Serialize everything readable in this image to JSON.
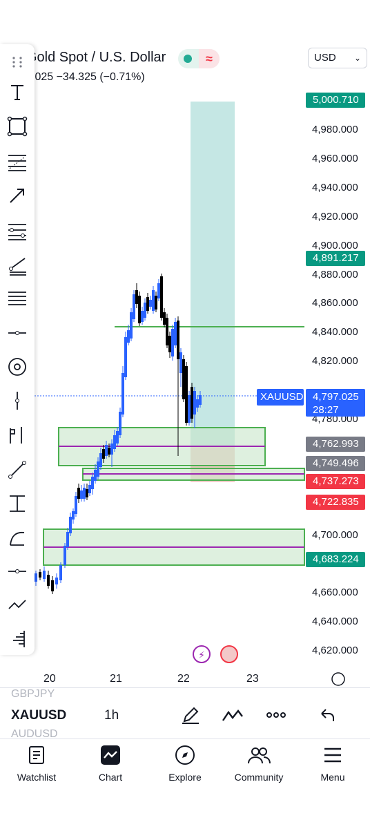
{
  "header": {
    "title": "Gold Spot / U.S. Dollar",
    "subtitle": ".025  −34.325 (−0.71%)",
    "currency": "USD"
  },
  "price_axis": {
    "ticks": [
      "4,980.000",
      "4,960.000",
      "4,940.000",
      "4,920.000",
      "4,900.000",
      "4,880.000",
      "4,860.000",
      "4,840.000",
      "4,820.000",
      "4,780.000",
      "4,700.000",
      "4,660.000",
      "4,640.000",
      "4,620.000"
    ],
    "tags": [
      {
        "text": "5,000.710",
        "color": "#089981"
      },
      {
        "text": "4,891.217",
        "color": "#089981"
      },
      {
        "text": "4,762.993",
        "color": "#787b86"
      },
      {
        "text": "4,749.496",
        "color": "#787b86"
      },
      {
        "text": "4,737.273",
        "color": "#f23645"
      },
      {
        "text": "4,722.835",
        "color": "#f23645"
      },
      {
        "text": "4,683.224",
        "color": "#089981"
      }
    ],
    "current": {
      "symbol": "XAUUSD",
      "price": "4,797.025",
      "countdown": "28:27",
      "color": "#2962ff"
    }
  },
  "time_axis": [
    "20",
    "21",
    "22",
    "23"
  ],
  "bottom_strip": {
    "prev_symbol": "GBPJPY",
    "symbol": "XAUUSD",
    "interval": "1h",
    "next_symbol": "AUDUSD"
  },
  "nav": [
    {
      "label": "Watchlist",
      "icon": "watchlist-icon"
    },
    {
      "label": "Chart",
      "icon": "chart-icon"
    },
    {
      "label": "Explore",
      "icon": "explore-icon"
    },
    {
      "label": "Community",
      "icon": "community-icon"
    },
    {
      "label": "Menu",
      "icon": "menu-icon"
    }
  ],
  "colors": {
    "bull": "#2962ff",
    "bear": "#000000",
    "zone_fill": "#d4ecd4",
    "zone_border": "#4caf50",
    "mid_line": "#9c27b0",
    "target": "#b2dfdb",
    "stop": "#f3c9c9"
  }
}
